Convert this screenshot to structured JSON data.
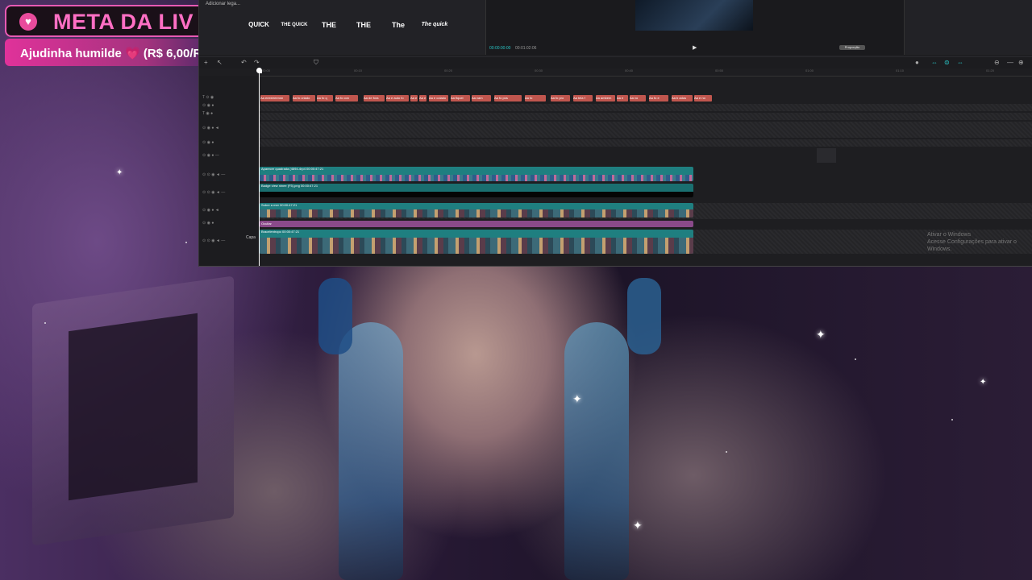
{
  "goal": {
    "title": "META DA LIV",
    "subtitle": "Ajudinha humilde 💗 (R$ 6,00/R",
    "heart_icon": "heart-icon",
    "accent": "#e85ab4"
  },
  "editor": {
    "add_caption_label": "Adicionar lega...",
    "text_styles": [
      "QUICK",
      "THE QUICK",
      "THE",
      "THE",
      "The",
      "The quick"
    ],
    "timecode_current": "00:00:00:00",
    "timecode_total": "00:01:02:06",
    "fit_label": "Proporção",
    "ruler_ticks": [
      "00:00",
      "00:10",
      "00:20",
      "00:30",
      "00:40",
      "00:50",
      "01:00",
      "01:10",
      "01:20"
    ],
    "caption_clips": [
      "Aa eeeeeeennn",
      "Aa fo criado",
      "Aa fo q",
      "Aa fo con",
      "Aa de fora",
      "Aa e auto fo",
      "Aa e",
      "Aa e",
      "Aa e colado",
      "Aa fiquei",
      "Aa vam",
      "Aa fo pos",
      "Aa fo",
      "Aa fo pro",
      "Aa tela f",
      "Aa ambem",
      "Aa e",
      "Aa vo",
      "Aa fo e",
      "Aa b adus",
      "Aa e no"
    ],
    "clip_labels": {
      "track1": "Aparecer quadrada   (4694-4rp4   00:00:47:21",
      "track2": "Badge view ninee (F5).png   00:00:47:21",
      "track3": "Sobre a mer   00:00:47:21",
      "track4": "Ocultar",
      "track5": "Bracelentropo   00:00:47:21"
    },
    "cover_label": "Capa",
    "accent": "#29c4c4"
  },
  "windows_watermark": {
    "line1": "Ativar o Windows",
    "line2": "Acesse Configurações para ativar o Windows."
  }
}
